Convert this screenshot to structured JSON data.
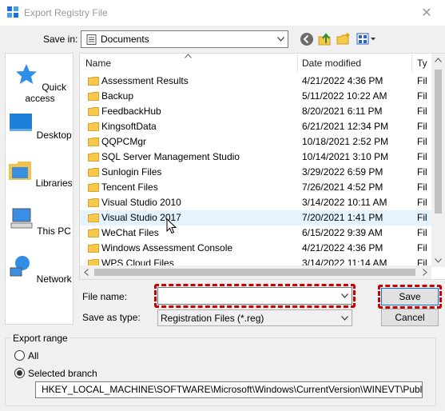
{
  "window": {
    "title": "Export Registry File",
    "close_glyph": "✕"
  },
  "save_in": {
    "label": "Save in:",
    "value": "Documents"
  },
  "toolbar": {
    "icons": [
      "back-icon",
      "up-folder-icon",
      "new-folder-icon",
      "view-menu-icon"
    ]
  },
  "places": [
    {
      "label": "Quick access",
      "icon": "quick-access-star-icon"
    },
    {
      "label": "Desktop",
      "icon": "desktop-icon"
    },
    {
      "label": "Libraries",
      "icon": "libraries-icon"
    },
    {
      "label": "This PC",
      "icon": "this-pc-icon"
    },
    {
      "label": "Network",
      "icon": "network-icon"
    }
  ],
  "columns": {
    "name": "Name",
    "date": "Date modified",
    "type": "Ty"
  },
  "files": [
    {
      "name": "Assessment Results",
      "date": "4/21/2022 4:36 PM",
      "type": "Fil"
    },
    {
      "name": "Backup",
      "date": "5/11/2022 10:22 AM",
      "type": "Fil"
    },
    {
      "name": "FeedbackHub",
      "date": "8/20/2021 6:11 PM",
      "type": "Fil"
    },
    {
      "name": "KingsoftData",
      "date": "6/21/2021 12:34 PM",
      "type": "Fil"
    },
    {
      "name": "QQPCMgr",
      "date": "10/18/2021 2:52 PM",
      "type": "Fil"
    },
    {
      "name": "SQL Server Management Studio",
      "date": "10/14/2021 3:10 PM",
      "type": "Fil"
    },
    {
      "name": "Sunlogin Files",
      "date": "3/29/2022 6:59 PM",
      "type": "Fil"
    },
    {
      "name": "Tencent Files",
      "date": "7/26/2021 4:52 PM",
      "type": "Fil"
    },
    {
      "name": "Visual Studio 2010",
      "date": "3/14/2022 10:11 AM",
      "type": "Fil"
    },
    {
      "name": "Visual Studio 2017",
      "date": "7/20/2021 1:41 PM",
      "type": "Fil"
    },
    {
      "name": "WeChat Files",
      "date": "6/15/2022 9:39 AM",
      "type": "Fil"
    },
    {
      "name": "Windows Assessment Console",
      "date": "4/21/2022 4:36 PM",
      "type": "Fil"
    },
    {
      "name": "WPS Cloud Files",
      "date": "3/14/2022 11:14 AM",
      "type": "Fil"
    }
  ],
  "hovered_row": "Visual Studio 2017",
  "file_name": {
    "label": "File name:",
    "value": ""
  },
  "save_as_type": {
    "label": "Save as type:",
    "value": "Registration Files (*.reg)"
  },
  "buttons": {
    "save": "Save",
    "cancel": "Cancel"
  },
  "export_range": {
    "label": "Export range",
    "all_label": "All",
    "selected_label": "Selected branch",
    "selected": "Selected branch",
    "path": "HKEY_LOCAL_MACHINE\\SOFTWARE\\Microsoft\\Windows\\CurrentVersion\\WINEVT\\Publishers"
  },
  "colors": {
    "highlight_dash": "#cc0000",
    "hover_row": "#e5f3ff",
    "folder": "#f7c84a"
  }
}
